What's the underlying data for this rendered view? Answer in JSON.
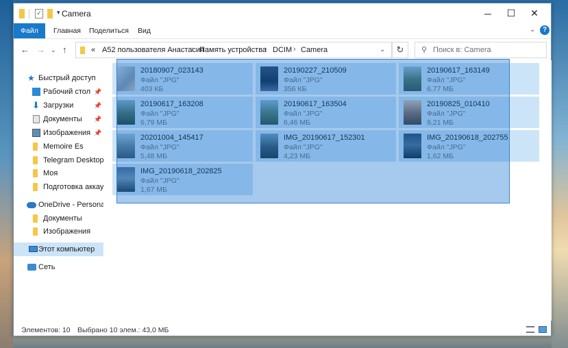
{
  "window": {
    "title": "Camera"
  },
  "ribbon": {
    "tabs": [
      "Файл",
      "Главная",
      "Поделиться",
      "Вид"
    ]
  },
  "address": {
    "prefix": "«",
    "crumbs": [
      "A52 пользователя Анастасия",
      "Память устройства",
      "DCIM",
      "Camera"
    ]
  },
  "search": {
    "placeholder": "Поиск в: Camera"
  },
  "nav": {
    "quick_access": "Быстрый доступ",
    "items": [
      "Рабочий стол",
      "Загрузки",
      "Документы",
      "Изображения",
      "Memoire Es",
      "Telegram Desktop",
      "Моя",
      "Подготовка аккаун"
    ],
    "onedrive": "OneDrive - Personal",
    "onedrive_items": [
      "Документы",
      "Изображения"
    ],
    "this_pc": "Этот компьютер",
    "network": "Сеть"
  },
  "files": [
    {
      "name": "20180907_023143",
      "type": "Файл \"JPG\"",
      "size": "403 КБ"
    },
    {
      "name": "20190227_210509",
      "type": "Файл \"JPG\"",
      "size": "356 КБ"
    },
    {
      "name": "20190617_163149",
      "type": "Файл \"JPG\"",
      "size": "6,77 МБ"
    },
    {
      "name": "20190617_163208",
      "type": "Файл \"JPG\"",
      "size": "6,79 МБ"
    },
    {
      "name": "20190617_163504",
      "type": "Файл \"JPG\"",
      "size": "6,46 МБ"
    },
    {
      "name": "20190825_010410",
      "type": "Файл \"JPG\"",
      "size": "9,21 МБ"
    },
    {
      "name": "20201004_145417",
      "type": "Файл \"JPG\"",
      "size": "5,48 МБ"
    },
    {
      "name": "IMG_20190617_152301",
      "type": "Файл \"JPG\"",
      "size": "4,23 МБ"
    },
    {
      "name": "IMG_20190618_202755",
      "type": "Файл \"JPG\"",
      "size": "1,62 МБ"
    },
    {
      "name": "IMG_20190618_202825",
      "type": "Файл \"JPG\"",
      "size": "1,67 МБ"
    }
  ],
  "status": {
    "count": "Элементов: 10",
    "selected": "Выбрано 10 элем.: 43,0 МБ"
  },
  "colors": {
    "accent": "#1979ca",
    "selection": "#cce4f7",
    "folder": "#f6c646"
  }
}
